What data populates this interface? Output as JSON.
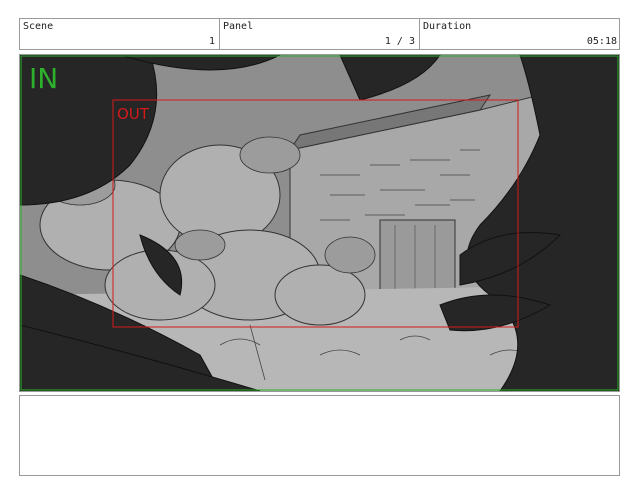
{
  "header": {
    "scene": {
      "label": "Scene",
      "value": "1"
    },
    "panel": {
      "label": "Panel",
      "value": "1 / 3"
    },
    "duration": {
      "label": "Duration",
      "value": "05:18"
    }
  },
  "frame": {
    "in_label": "IN",
    "out_label": "OUT",
    "colors": {
      "in_box": "#2db12d",
      "out_box": "#d41a1a"
    }
  },
  "notes": {
    "text": ""
  }
}
